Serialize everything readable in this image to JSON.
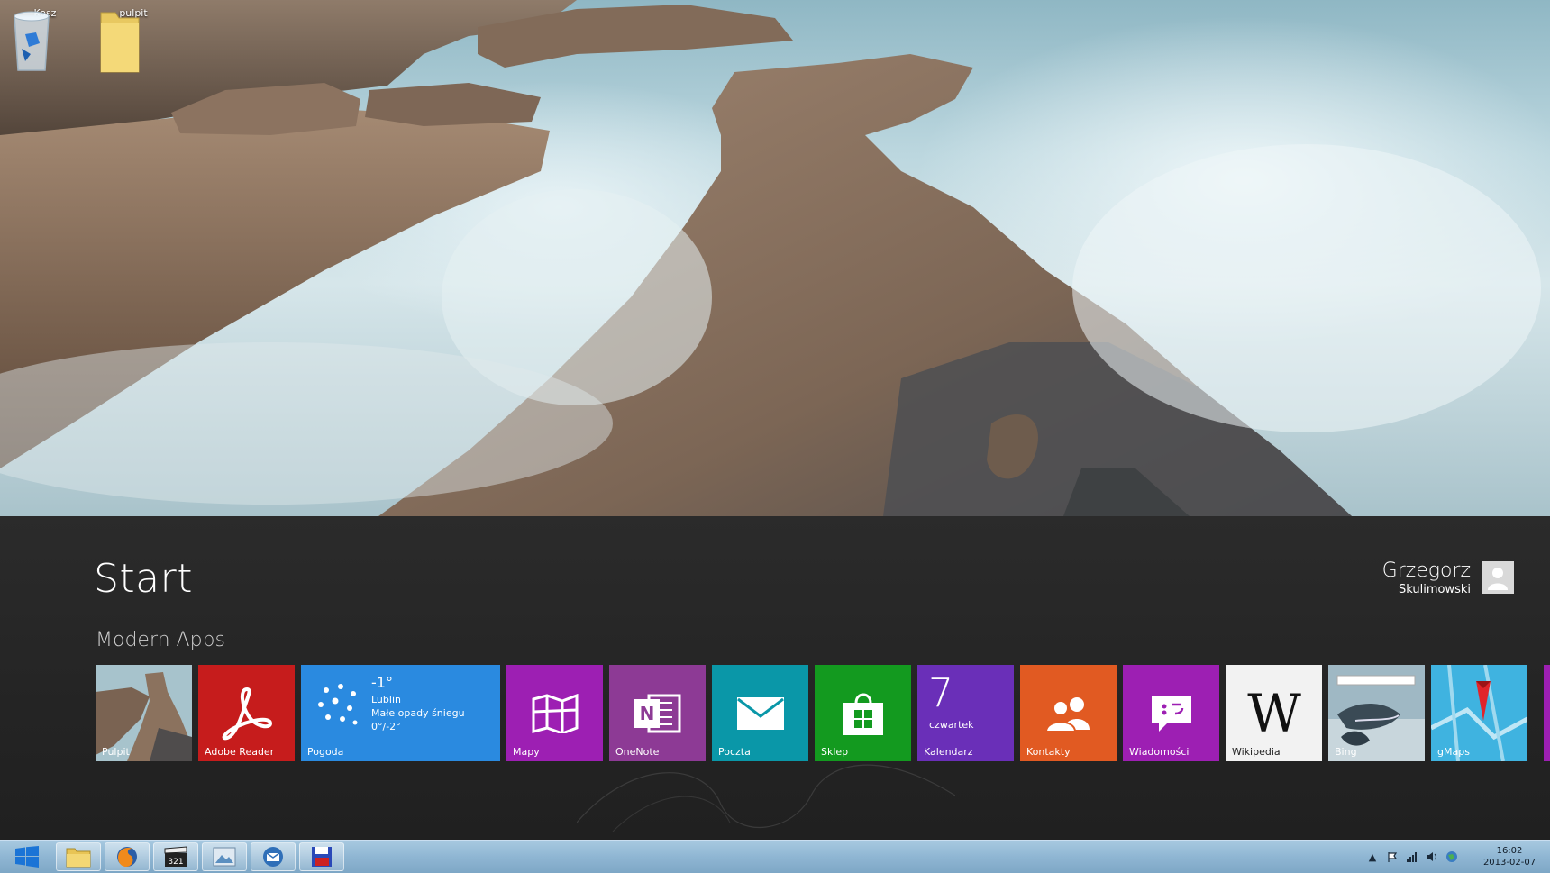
{
  "desktop": {
    "icons": [
      {
        "label": "Kosz",
        "icon": "recycle-bin-icon"
      },
      {
        "label": "pulpit",
        "icon": "folder-icon"
      }
    ]
  },
  "start": {
    "title": "Start",
    "group_title": "Modern Apps",
    "user": {
      "first_name": "Grzegorz",
      "last_name": "Skulimowski"
    },
    "tiles": [
      {
        "label": "Pulpit",
        "color": "#6b5a4c",
        "icon": "desktop-wallpaper-thumbnail"
      },
      {
        "label": "Adobe Reader",
        "color": "#c61c1c",
        "icon": "adobe-reader-icon"
      },
      {
        "label": "Pogoda",
        "color": "#2a8ae0",
        "icon": "weather-snow-icon",
        "temp": "-1°",
        "city": "Lublin",
        "condition": "Małe opady śniegu",
        "range": "0°/-2°"
      },
      {
        "label": "Mapy",
        "color": "#9d1fb3",
        "icon": "maps-icon"
      },
      {
        "label": "OneNote",
        "color": "#8d3a95",
        "icon": "onenote-icon"
      },
      {
        "label": "Poczta",
        "color": "#0a97a8",
        "icon": "mail-icon"
      },
      {
        "label": "Sklep",
        "color": "#139a1f",
        "icon": "store-icon"
      },
      {
        "label": "Kalendarz",
        "color": "#6a2fb8",
        "icon": "calendar-icon",
        "day": "7",
        "weekday": "czwartek"
      },
      {
        "label": "Kontakty",
        "color": "#e15a22",
        "icon": "people-icon"
      },
      {
        "label": "Wiadomości",
        "color": "#9d1fb3",
        "icon": "messaging-icon"
      },
      {
        "label": "Wikipedia",
        "color": "#f2f2f2",
        "icon": "wikipedia-icon"
      },
      {
        "label": "Bing",
        "color": "#3d6e86",
        "icon": "bing-dolphin-image"
      },
      {
        "label": "gMaps",
        "color": "#21a3d8",
        "icon": "gmaps-pin-icon"
      }
    ]
  },
  "taskbar": {
    "apps": [
      {
        "name": "file-explorer",
        "icon": "folder-icon"
      },
      {
        "name": "firefox",
        "icon": "firefox-icon"
      },
      {
        "name": "media-321",
        "icon": "clapper-321-icon"
      },
      {
        "name": "image-viewer",
        "icon": "picture-icon"
      },
      {
        "name": "thunderbird",
        "icon": "thunderbird-icon"
      },
      {
        "name": "save-app",
        "icon": "floppy-disk-icon"
      }
    ],
    "clock": {
      "time": "16:02",
      "date": "2013-02-07"
    }
  }
}
